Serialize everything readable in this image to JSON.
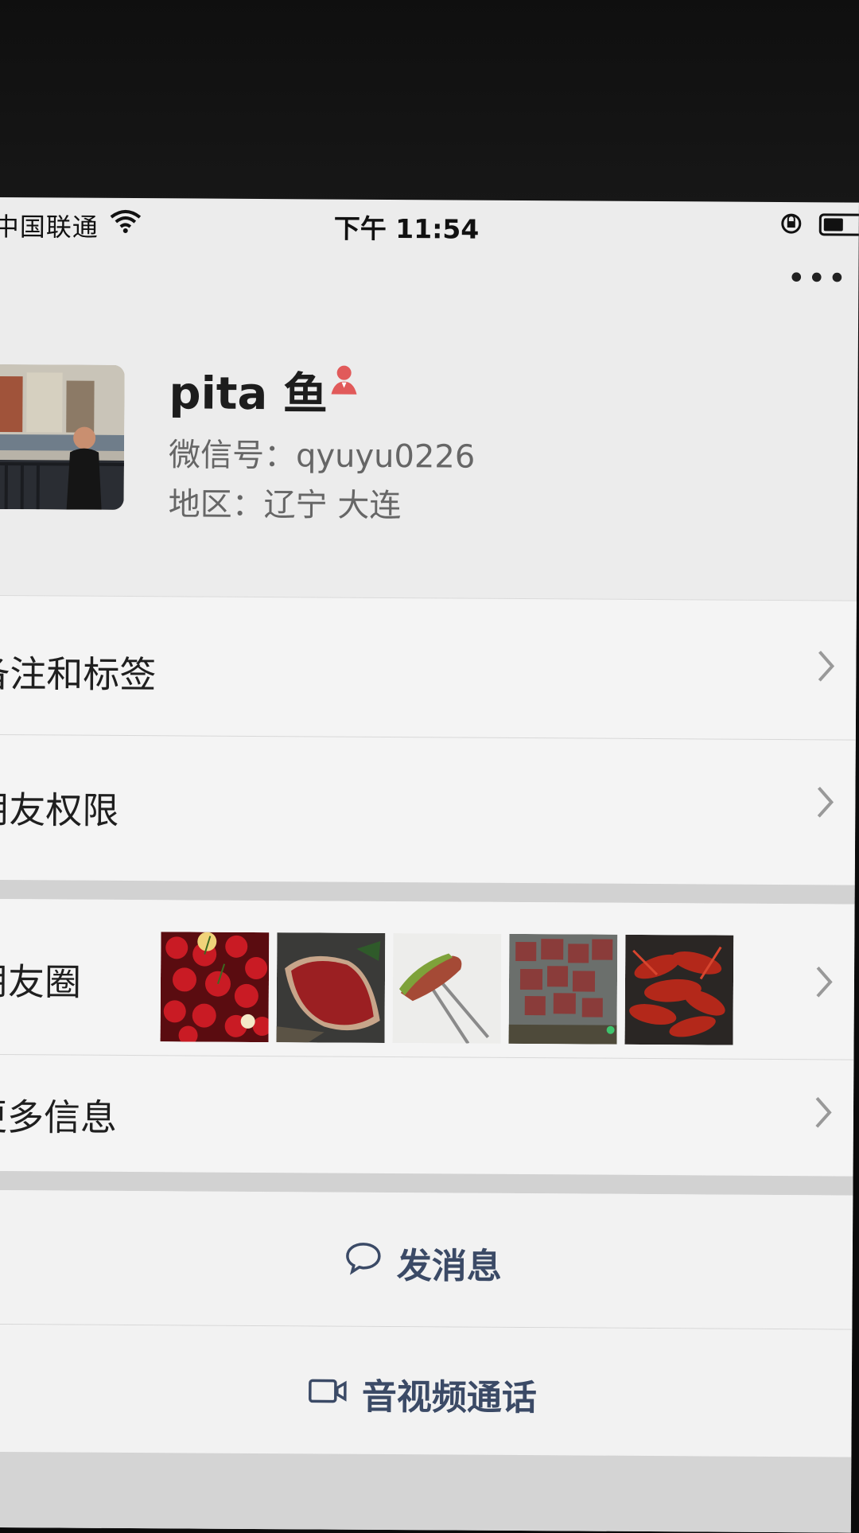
{
  "status_bar": {
    "carrier": "中国联通",
    "time": "下午 11:54"
  },
  "header": {
    "more_icon": "more-dots-icon"
  },
  "profile": {
    "name": "pita 鱼",
    "gender_icon": "female-icon",
    "wechat_id": "微信号：qyuyu0226",
    "region": "地区：辽宁 大连"
  },
  "rows": [
    {
      "label": "备注和标签"
    },
    {
      "label": "朋友权限"
    },
    {
      "label": "朋友圈"
    },
    {
      "label": "更多信息"
    }
  ],
  "actions": {
    "message": "发消息",
    "call": "音视频通话"
  },
  "colors": {
    "accent_link": "#3b4a66",
    "female_icon": "#e15a5a"
  }
}
